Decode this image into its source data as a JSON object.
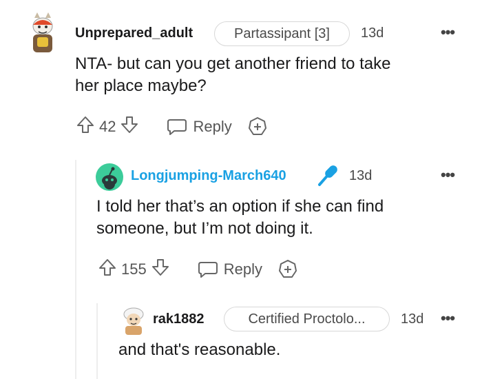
{
  "comments": [
    {
      "username": "Unprepared_adult",
      "flair": "Partassipant [3]",
      "time": "13d",
      "more": "•••",
      "body_lines": [
        "NTA- but can you get another friend to take",
        "her place maybe?"
      ],
      "votes": "42",
      "reply_label": "Reply",
      "avatar_icon": "cartoon-avatar-icon"
    },
    {
      "username": "Longjumping-March640",
      "time": "13d",
      "more": "•••",
      "body_lines": [
        "I told her that’s an option if she can find",
        "someone, but I’m not doing it."
      ],
      "votes": "155",
      "reply_label": "Reply",
      "avatar_icon": "snoo-avatar-icon",
      "badge_icon": "microphone-icon",
      "username_color": "#1aa1e3"
    },
    {
      "username": "rak1882",
      "flair": "Certified Proctolo...",
      "time": "13d",
      "more": "•••",
      "body_lines": [
        "and that's reasonable."
      ],
      "avatar_icon": "cartoon-avatar-icon"
    }
  ],
  "colors": {
    "text": "#1a1a1b",
    "muted": "#555555",
    "op_blue": "#1aa1e3",
    "thread_line": "#ededed"
  }
}
